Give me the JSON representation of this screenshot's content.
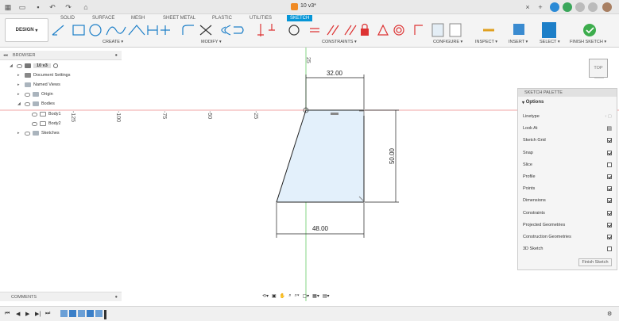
{
  "doc": {
    "title": "10 v3*"
  },
  "workspace": {
    "label": "DESIGN"
  },
  "tabs": [
    {
      "label": "SOLID"
    },
    {
      "label": "SURFACE"
    },
    {
      "label": "MESH"
    },
    {
      "label": "SHEET METAL"
    },
    {
      "label": "PLASTIC"
    },
    {
      "label": "UTILITIES"
    },
    {
      "label": "SKETCH"
    }
  ],
  "groups": {
    "create": "CREATE",
    "modify": "MODIFY",
    "constraints": "CONSTRAINTS",
    "configure": "CONFIGURE",
    "inspect": "INSPECT",
    "insert": "INSERT",
    "select": "SELECT",
    "finish": "FINISH SKETCH"
  },
  "browser": {
    "title": "BROWSER",
    "root": "10 v3",
    "items": [
      {
        "label": "Document Settings"
      },
      {
        "label": "Named Views"
      },
      {
        "label": "Origin"
      },
      {
        "label": "Bodies"
      },
      {
        "label": "Body1"
      },
      {
        "label": "Body2"
      },
      {
        "label": "Sketches"
      }
    ]
  },
  "comments": {
    "label": "COMMENTS"
  },
  "canvas": {
    "dims": {
      "top": "32.00",
      "bottom": "48.00",
      "right": "50.00"
    },
    "ticks_x": [
      "-125",
      "-100",
      "-75",
      "-50",
      "-25"
    ],
    "tick_y": "25"
  },
  "viewcube": {
    "label": "TOP"
  },
  "palette": {
    "title": "SKETCH PALETTE",
    "section": "Options",
    "rows": [
      {
        "label": "Linetype",
        "state": "linetype"
      },
      {
        "label": "Look At",
        "state": "icon"
      },
      {
        "label": "Sketch Grid",
        "state": "on"
      },
      {
        "label": "Snap",
        "state": "on"
      },
      {
        "label": "Slice",
        "state": "off"
      },
      {
        "label": "Profile",
        "state": "on"
      },
      {
        "label": "Points",
        "state": "on"
      },
      {
        "label": "Dimensions",
        "state": "on"
      },
      {
        "label": "Constraints",
        "state": "on"
      },
      {
        "label": "Projected Geometries",
        "state": "on"
      },
      {
        "label": "Construction Geometries",
        "state": "on"
      },
      {
        "label": "3D Sketch",
        "state": "off"
      }
    ],
    "finish": "Finish Sketch"
  }
}
